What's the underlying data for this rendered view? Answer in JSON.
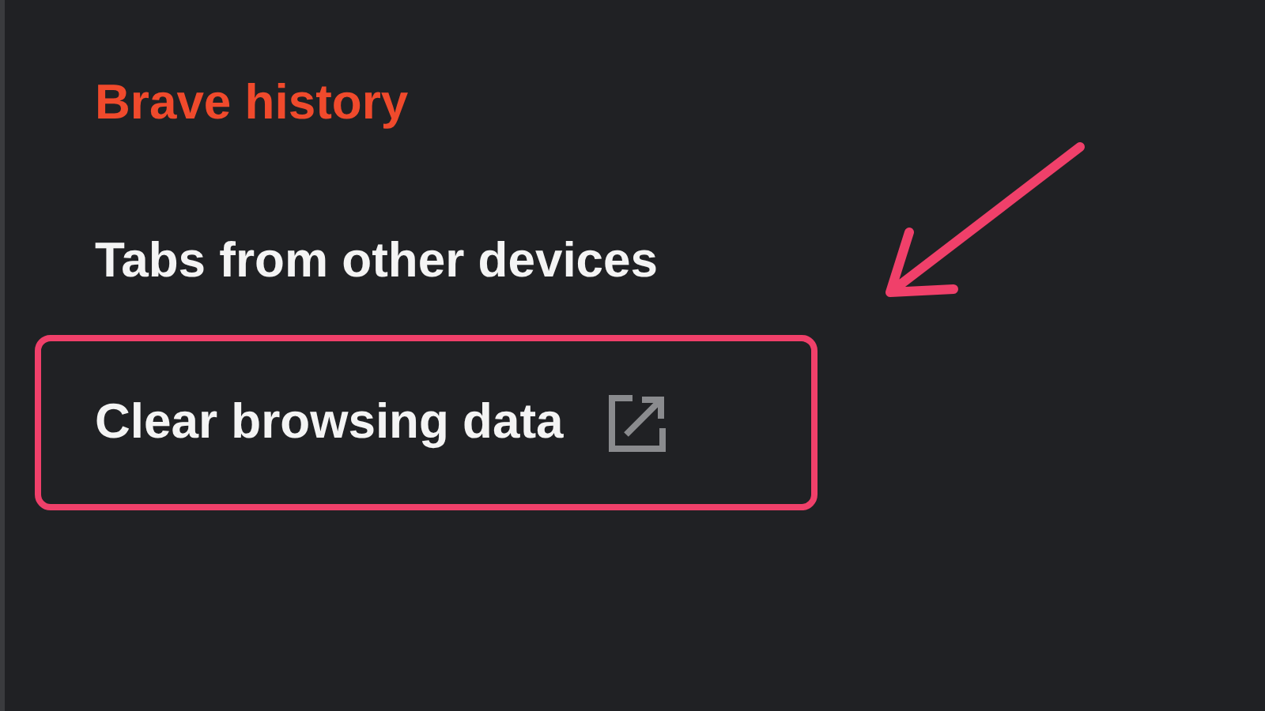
{
  "menu": {
    "items": [
      {
        "label": "Brave history",
        "selected": true,
        "external": false,
        "highlighted": false
      },
      {
        "label": "Tabs from other devices",
        "selected": false,
        "external": false,
        "highlighted": false
      },
      {
        "label": "Clear browsing data",
        "selected": false,
        "external": true,
        "highlighted": true
      }
    ]
  },
  "annotation": {
    "arrow": true
  }
}
